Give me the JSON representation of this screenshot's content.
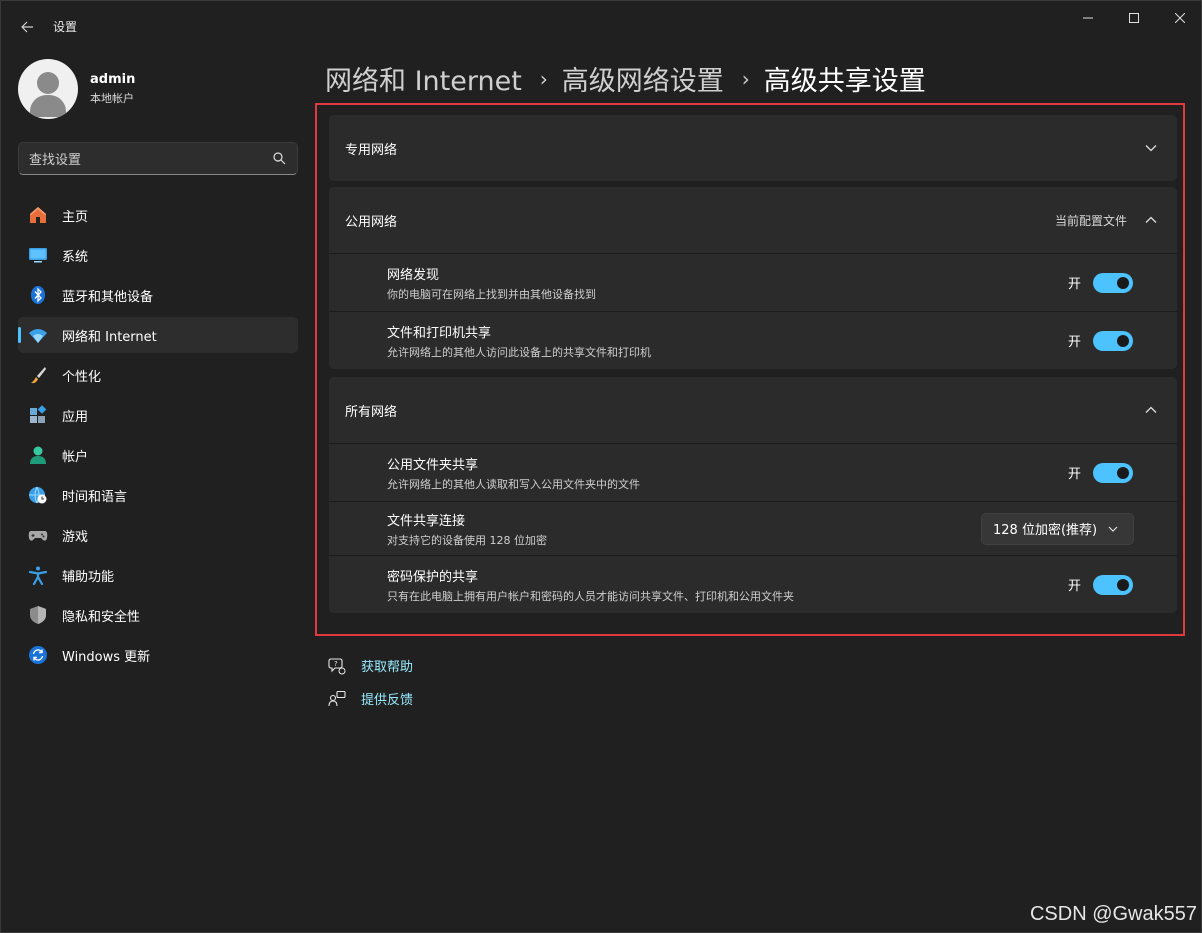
{
  "window": {
    "title": "设置"
  },
  "profile": {
    "name": "admin",
    "account_type": "本地帐户"
  },
  "search": {
    "placeholder": "查找设置"
  },
  "nav": {
    "items": [
      {
        "label": "主页",
        "icon": "home-icon"
      },
      {
        "label": "系统",
        "icon": "system-icon"
      },
      {
        "label": "蓝牙和其他设备",
        "icon": "bluetooth-icon"
      },
      {
        "label": "网络和 Internet",
        "icon": "wifi-icon",
        "active": true
      },
      {
        "label": "个性化",
        "icon": "brush-icon"
      },
      {
        "label": "应用",
        "icon": "apps-icon"
      },
      {
        "label": "帐户",
        "icon": "account-icon"
      },
      {
        "label": "时间和语言",
        "icon": "globe-clock-icon"
      },
      {
        "label": "游戏",
        "icon": "gamepad-icon"
      },
      {
        "label": "辅助功能",
        "icon": "accessibility-icon"
      },
      {
        "label": "隐私和安全性",
        "icon": "shield-icon"
      },
      {
        "label": "Windows 更新",
        "icon": "update-icon"
      }
    ]
  },
  "breadcrumb": [
    "网络和 Internet",
    "高级网络设置",
    "高级共享设置"
  ],
  "sections": {
    "private": {
      "title": "专用网络"
    },
    "public": {
      "title": "公用网络",
      "aux": "当前配置文件",
      "rows": [
        {
          "title": "网络发现",
          "desc": "你的电脑可在网络上找到并由其他设备找到",
          "toggle_label": "开",
          "on": true
        },
        {
          "title": "文件和打印机共享",
          "desc": "允许网络上的其他人访问此设备上的共享文件和打印机",
          "toggle_label": "开",
          "on": true
        }
      ]
    },
    "all": {
      "title": "所有网络",
      "public_folder": {
        "title": "公用文件夹共享",
        "desc": "允许网络上的其他人读取和写入公用文件夹中的文件",
        "toggle_label": "开",
        "on": true
      },
      "file_sharing": {
        "title": "文件共享连接",
        "desc": "对支持它的设备使用 128 位加密",
        "value": "128 位加密(推荐)"
      },
      "password": {
        "title": "密码保护的共享",
        "desc": "只有在此电脑上拥有用户帐户和密码的人员才能访问共享文件、打印机和公用文件夹",
        "toggle_label": "开",
        "on": true
      }
    }
  },
  "links": {
    "help": "获取帮助",
    "feedback": "提供反馈"
  },
  "watermark": "CSDN @Gwak557",
  "colors": {
    "accent": "#4cc2ff",
    "highlight": "#e0393e",
    "link": "#99ebff",
    "background": "#202020"
  }
}
